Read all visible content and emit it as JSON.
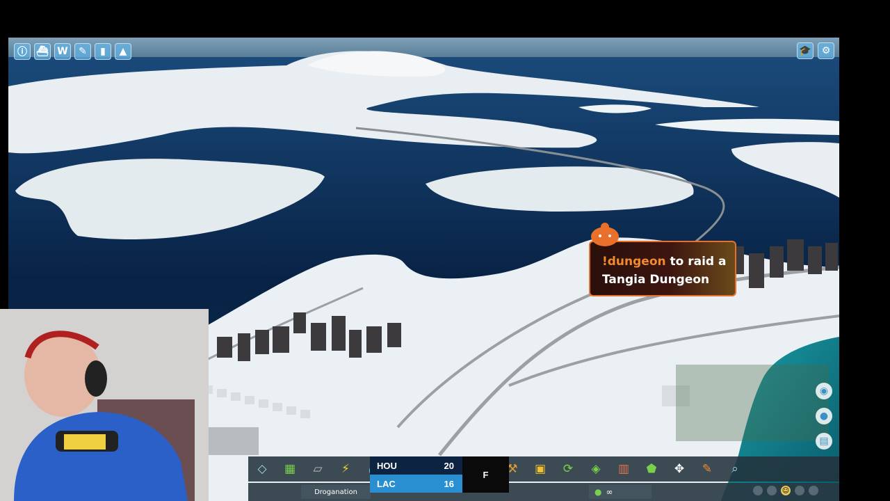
{
  "top_left_icons": [
    "info-icon",
    "transport-icon",
    "wiki-icon",
    "bulldoze-icon",
    "traffic-light-icon",
    "cone-icon"
  ],
  "top_right_icons": [
    "tutorial-icon",
    "settings-icon"
  ],
  "dungeon": {
    "command": "!dungeon",
    "line1_rest": " to raid a",
    "line2": "Tangia Dungeon",
    "accent": "#e8702a"
  },
  "toolbar": {
    "tools": [
      "roads-icon",
      "zoning-icon",
      "areas-icon",
      "electricity-icon",
      "water-icon",
      "services-icon",
      "parks-icon",
      "landscaping-icon",
      "transport-icon",
      "industry-icon",
      "transit-icon",
      "terrain-icon",
      "districts-icon",
      "mail-icon",
      "move-icon",
      "paint-icon",
      "info-view-icon",
      "bulldozer-icon"
    ],
    "city_name": "Droganation",
    "money": "∞"
  },
  "score": {
    "team1": "HOU",
    "score1": "20",
    "team2": "LAC",
    "score2": "16",
    "period": "F",
    "team1_color": "#0c2342",
    "team2_color": "#2a8fd0"
  },
  "right_tools": [
    "info-pin-icon",
    "citizen-icon",
    "notes-icon"
  ]
}
